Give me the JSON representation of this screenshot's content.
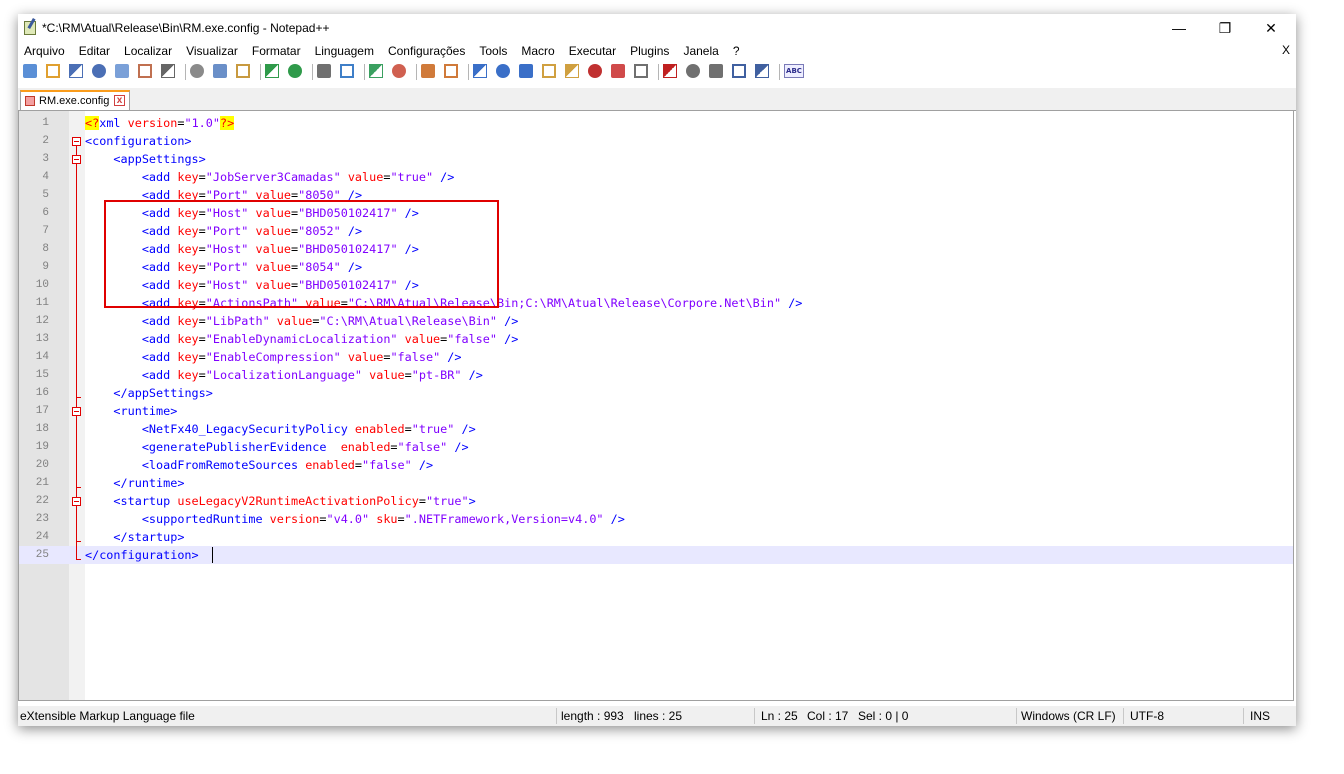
{
  "window": {
    "title": "*C:\\RM\\Atual\\Release\\Bin\\RM.exe.config - Notepad++",
    "minimize": "—",
    "restore": "❐",
    "close": "✕"
  },
  "menu": {
    "items": [
      "Arquivo",
      "Editar",
      "Localizar",
      "Visualizar",
      "Formatar",
      "Linguagem",
      "Configurações",
      "Tools",
      "Macro",
      "Executar",
      "Plugins",
      "Janela",
      "?"
    ],
    "close": "X"
  },
  "toolbar": {
    "spell_label": "ABC",
    "icons": [
      "new-file-icon",
      "open-file-icon",
      "save-icon",
      "save-all-icon",
      "close-icon",
      "close-all-icon",
      "print-icon",
      "cut-icon",
      "copy-icon",
      "paste-icon",
      "undo-icon",
      "redo-icon",
      "find-icon",
      "replace-icon",
      "zoom-in-icon",
      "zoom-out-icon",
      "sync-vertical-icon",
      "sync-horizontal-icon",
      "word-wrap-icon",
      "show-all-chars-icon",
      "indent-guide-icon",
      "lang-icon",
      "doc-map-icon",
      "function-list-icon",
      "folder-workspace-icon",
      "monitor-icon",
      "record-macro-icon",
      "stop-record-icon",
      "play-macro-icon",
      "run-macro-multiple-icon",
      "save-macro-icon",
      "spell-check-icon"
    ]
  },
  "tab": {
    "label": "RM.exe.config",
    "close": "x"
  },
  "editor": {
    "lines": [
      {
        "n": "1",
        "t": [
          [
            "hl",
            "<?"
          ],
          [
            "tag",
            "xml "
          ],
          [
            "attr",
            "version"
          ],
          [
            "plain",
            "="
          ],
          [
            "val",
            "\"1.0\""
          ],
          [
            "hl",
            "?>"
          ]
        ]
      },
      {
        "n": "2",
        "t": [
          [
            "tag",
            "<configuration>"
          ]
        ]
      },
      {
        "n": "3",
        "t": [
          [
            "plain",
            "    "
          ],
          [
            "tag",
            "<appSettings>"
          ]
        ]
      },
      {
        "n": "4",
        "t": [
          [
            "plain",
            "        "
          ],
          [
            "tag",
            "<add "
          ],
          [
            "attr",
            "key"
          ],
          [
            "plain",
            "="
          ],
          [
            "val",
            "\"JobServer3Camadas\""
          ],
          [
            "attr",
            " value"
          ],
          [
            "plain",
            "="
          ],
          [
            "val",
            "\"true\""
          ],
          [
            "tag",
            " />"
          ]
        ]
      },
      {
        "n": "5",
        "t": [
          [
            "plain",
            "        "
          ],
          [
            "tag",
            "<add "
          ],
          [
            "attr",
            "key"
          ],
          [
            "plain",
            "="
          ],
          [
            "val",
            "\"Port\""
          ],
          [
            "attr",
            " value"
          ],
          [
            "plain",
            "="
          ],
          [
            "val",
            "\"8050\""
          ],
          [
            "tag",
            " />"
          ]
        ]
      },
      {
        "n": "6",
        "t": [
          [
            "plain",
            "        "
          ],
          [
            "tag",
            "<add "
          ],
          [
            "attr",
            "key"
          ],
          [
            "plain",
            "="
          ],
          [
            "val",
            "\"Host\""
          ],
          [
            "attr",
            " value"
          ],
          [
            "plain",
            "="
          ],
          [
            "val",
            "\"BHD050102417\""
          ],
          [
            "tag",
            " />"
          ]
        ]
      },
      {
        "n": "7",
        "t": [
          [
            "plain",
            "        "
          ],
          [
            "tag",
            "<add "
          ],
          [
            "attr",
            "key"
          ],
          [
            "plain",
            "="
          ],
          [
            "val",
            "\"Port\""
          ],
          [
            "attr",
            " value"
          ],
          [
            "plain",
            "="
          ],
          [
            "val",
            "\"8052\""
          ],
          [
            "tag",
            " />"
          ]
        ]
      },
      {
        "n": "8",
        "t": [
          [
            "plain",
            "        "
          ],
          [
            "tag",
            "<add "
          ],
          [
            "attr",
            "key"
          ],
          [
            "plain",
            "="
          ],
          [
            "val",
            "\"Host\""
          ],
          [
            "attr",
            " value"
          ],
          [
            "plain",
            "="
          ],
          [
            "val",
            "\"BHD050102417\""
          ],
          [
            "tag",
            " />"
          ]
        ]
      },
      {
        "n": "9",
        "t": [
          [
            "plain",
            "        "
          ],
          [
            "tag",
            "<add "
          ],
          [
            "attr",
            "key"
          ],
          [
            "plain",
            "="
          ],
          [
            "val",
            "\"Port\""
          ],
          [
            "attr",
            " value"
          ],
          [
            "plain",
            "="
          ],
          [
            "val",
            "\"8054\""
          ],
          [
            "tag",
            " />"
          ]
        ]
      },
      {
        "n": "10",
        "t": [
          [
            "plain",
            "        "
          ],
          [
            "tag",
            "<add "
          ],
          [
            "attr",
            "key"
          ],
          [
            "plain",
            "="
          ],
          [
            "val",
            "\"Host\""
          ],
          [
            "attr",
            " value"
          ],
          [
            "plain",
            "="
          ],
          [
            "val",
            "\"BHD050102417\""
          ],
          [
            "tag",
            " />"
          ]
        ]
      },
      {
        "n": "11",
        "t": [
          [
            "plain",
            "        "
          ],
          [
            "tag",
            "<add "
          ],
          [
            "attr",
            "key"
          ],
          [
            "plain",
            "="
          ],
          [
            "val",
            "\"ActionsPath\""
          ],
          [
            "attr",
            " value"
          ],
          [
            "plain",
            "="
          ],
          [
            "val",
            "\"C:\\RM\\Atual\\Release\\Bin;C:\\RM\\Atual\\Release\\Corpore.Net\\Bin\""
          ],
          [
            "tag",
            " />"
          ]
        ]
      },
      {
        "n": "12",
        "t": [
          [
            "plain",
            "        "
          ],
          [
            "tag",
            "<add "
          ],
          [
            "attr",
            "key"
          ],
          [
            "plain",
            "="
          ],
          [
            "val",
            "\"LibPath\""
          ],
          [
            "attr",
            " value"
          ],
          [
            "plain",
            "="
          ],
          [
            "val",
            "\"C:\\RM\\Atual\\Release\\Bin\""
          ],
          [
            "tag",
            " />"
          ]
        ]
      },
      {
        "n": "13",
        "t": [
          [
            "plain",
            "        "
          ],
          [
            "tag",
            "<add "
          ],
          [
            "attr",
            "key"
          ],
          [
            "plain",
            "="
          ],
          [
            "val",
            "\"EnableDynamicLocalization\""
          ],
          [
            "attr",
            " value"
          ],
          [
            "plain",
            "="
          ],
          [
            "val",
            "\"false\""
          ],
          [
            "tag",
            " />"
          ]
        ]
      },
      {
        "n": "14",
        "t": [
          [
            "plain",
            "        "
          ],
          [
            "tag",
            "<add "
          ],
          [
            "attr",
            "key"
          ],
          [
            "plain",
            "="
          ],
          [
            "val",
            "\"EnableCompression\""
          ],
          [
            "attr",
            " value"
          ],
          [
            "plain",
            "="
          ],
          [
            "val",
            "\"false\""
          ],
          [
            "tag",
            " />"
          ]
        ]
      },
      {
        "n": "15",
        "t": [
          [
            "plain",
            "        "
          ],
          [
            "tag",
            "<add "
          ],
          [
            "attr",
            "key"
          ],
          [
            "plain",
            "="
          ],
          [
            "val",
            "\"LocalizationLanguage\""
          ],
          [
            "attr",
            " value"
          ],
          [
            "plain",
            "="
          ],
          [
            "val",
            "\"pt-BR\""
          ],
          [
            "tag",
            " />"
          ]
        ]
      },
      {
        "n": "16",
        "t": [
          [
            "plain",
            "    "
          ],
          [
            "tag",
            "</appSettings>"
          ]
        ]
      },
      {
        "n": "17",
        "t": [
          [
            "plain",
            "    "
          ],
          [
            "tag",
            "<runtime>"
          ]
        ]
      },
      {
        "n": "18",
        "t": [
          [
            "plain",
            "        "
          ],
          [
            "tag",
            "<NetFx40_LegacySecurityPolicy "
          ],
          [
            "attr",
            "enabled"
          ],
          [
            "plain",
            "="
          ],
          [
            "val",
            "\"true\""
          ],
          [
            "tag",
            " />"
          ]
        ]
      },
      {
        "n": "19",
        "t": [
          [
            "plain",
            "        "
          ],
          [
            "tag",
            "<generatePublisherEvidence  "
          ],
          [
            "attr",
            "enabled"
          ],
          [
            "plain",
            "="
          ],
          [
            "val",
            "\"false\""
          ],
          [
            "tag",
            " />"
          ]
        ]
      },
      {
        "n": "20",
        "t": [
          [
            "plain",
            "        "
          ],
          [
            "tag",
            "<loadFromRemoteSources "
          ],
          [
            "attr",
            "enabled"
          ],
          [
            "plain",
            "="
          ],
          [
            "val",
            "\"false\""
          ],
          [
            "tag",
            " />"
          ]
        ]
      },
      {
        "n": "21",
        "t": [
          [
            "plain",
            "    "
          ],
          [
            "tag",
            "</runtime>"
          ]
        ]
      },
      {
        "n": "22",
        "t": [
          [
            "plain",
            "    "
          ],
          [
            "tag",
            "<startup "
          ],
          [
            "attr",
            "useLegacyV2RuntimeActivationPolicy"
          ],
          [
            "plain",
            "="
          ],
          [
            "val",
            "\"true\""
          ],
          [
            "tag",
            ">"
          ]
        ]
      },
      {
        "n": "23",
        "t": [
          [
            "plain",
            "        "
          ],
          [
            "tag",
            "<supportedRuntime "
          ],
          [
            "attr",
            "version"
          ],
          [
            "plain",
            "="
          ],
          [
            "val",
            "\"v4.0\""
          ],
          [
            "attr",
            " sku"
          ],
          [
            "plain",
            "="
          ],
          [
            "val",
            "\".NETFramework,Version=v4.0\""
          ],
          [
            "tag",
            " />"
          ]
        ]
      },
      {
        "n": "24",
        "t": [
          [
            "plain",
            "    "
          ],
          [
            "tag",
            "</startup>"
          ]
        ]
      },
      {
        "n": "25",
        "t": [
          [
            "tag",
            "</configuration>"
          ]
        ]
      }
    ]
  },
  "status": {
    "file_type": "eXtensible Markup Language file",
    "length": "length : 993",
    "lines": "lines : 25",
    "ln": "Ln : 25",
    "col": "Col : 17",
    "sel": "Sel : 0 | 0",
    "eol": "Windows (CR LF)",
    "encoding": "UTF-8",
    "mode": "INS"
  },
  "colors": {
    "tag": "#0000ff",
    "attr": "#ff0000",
    "value": "#8000ff",
    "highlight_box": "#e00000",
    "current_line": "#e8e8ff"
  }
}
